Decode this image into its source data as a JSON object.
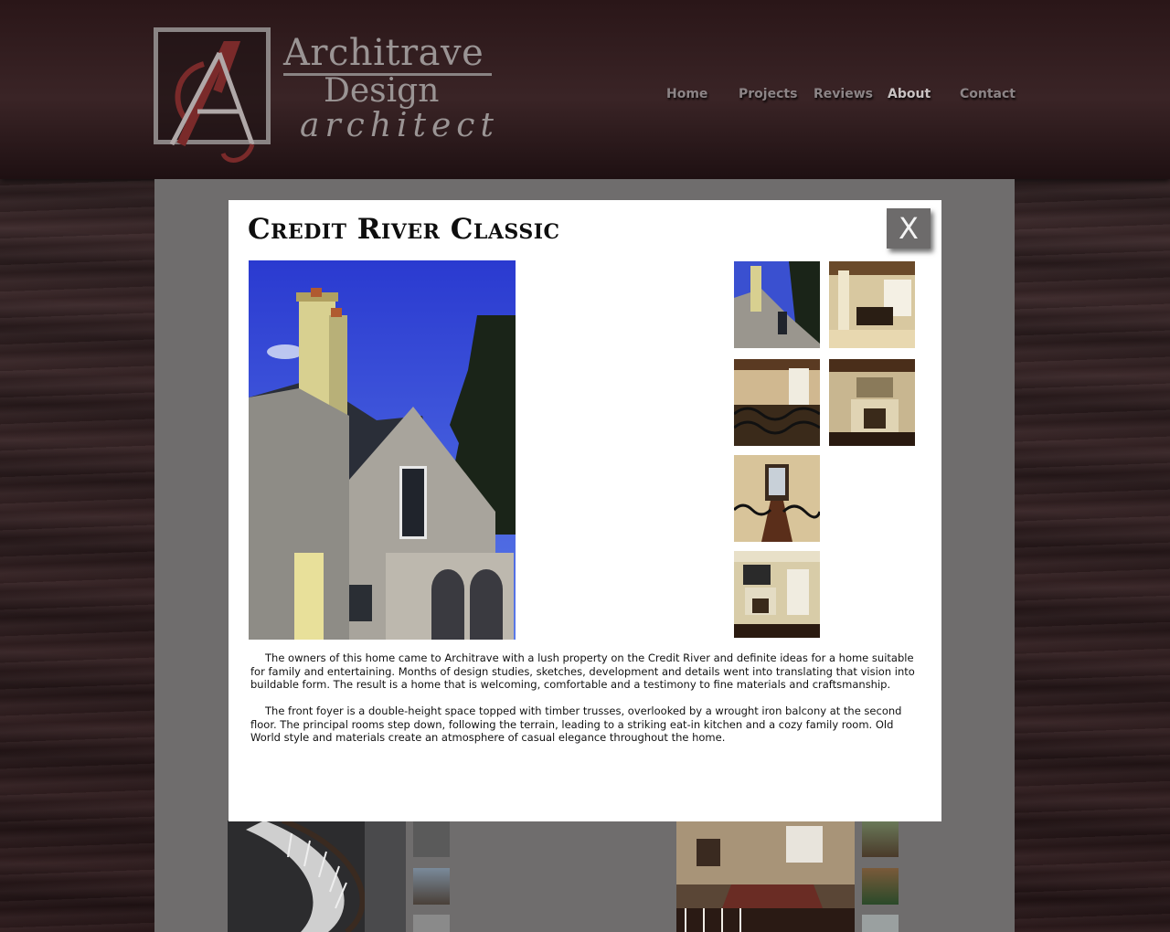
{
  "brand": {
    "name_line1": "Architrave",
    "name_line2": "Design",
    "name_line3": "architect",
    "logo_icon": "architrave-monogram-logo",
    "colors": {
      "logo_grey": "#8a8484",
      "logo_red": "#7a2a2a"
    }
  },
  "nav": {
    "items": [
      {
        "label": "Home"
      },
      {
        "label": "Projects"
      },
      {
        "label": "Reviews"
      },
      {
        "label": "About"
      },
      {
        "label": "Contact"
      }
    ],
    "active": "About"
  },
  "modal": {
    "title": "Credit River Classic",
    "close_label": "X",
    "main_photo": "house-exterior-stone-chimney",
    "thumbnails": [
      {
        "icon": "exterior-thumbnail"
      },
      {
        "icon": "kitchen-thumbnail"
      },
      {
        "icon": "balcony-thumbnail"
      },
      {
        "icon": "fireplace-thumbnail"
      },
      {
        "icon": "hallway-thumbnail"
      },
      {
        "icon": "family-room-thumbnail"
      }
    ],
    "paragraphs": [
      "The owners of this home came to Architrave with a lush property on the Credit River and definite ideas for a home suitable for family and entertaining. Months of design studies, sketches, development and details went into translating that vision into buildable form. The result is a home that is welcoming, comfortable and a testimony to fine materials and craftsmanship.",
      "The front foyer is a double-height space topped with timber trusses, overlooked by a wrought iron balcony at the second floor. The principal rooms step down, following the terrain, leading to a striking eat-in kitchen and a cozy family room. Old World style and materials create an atmosphere of casual elegance throughout the home."
    ]
  }
}
